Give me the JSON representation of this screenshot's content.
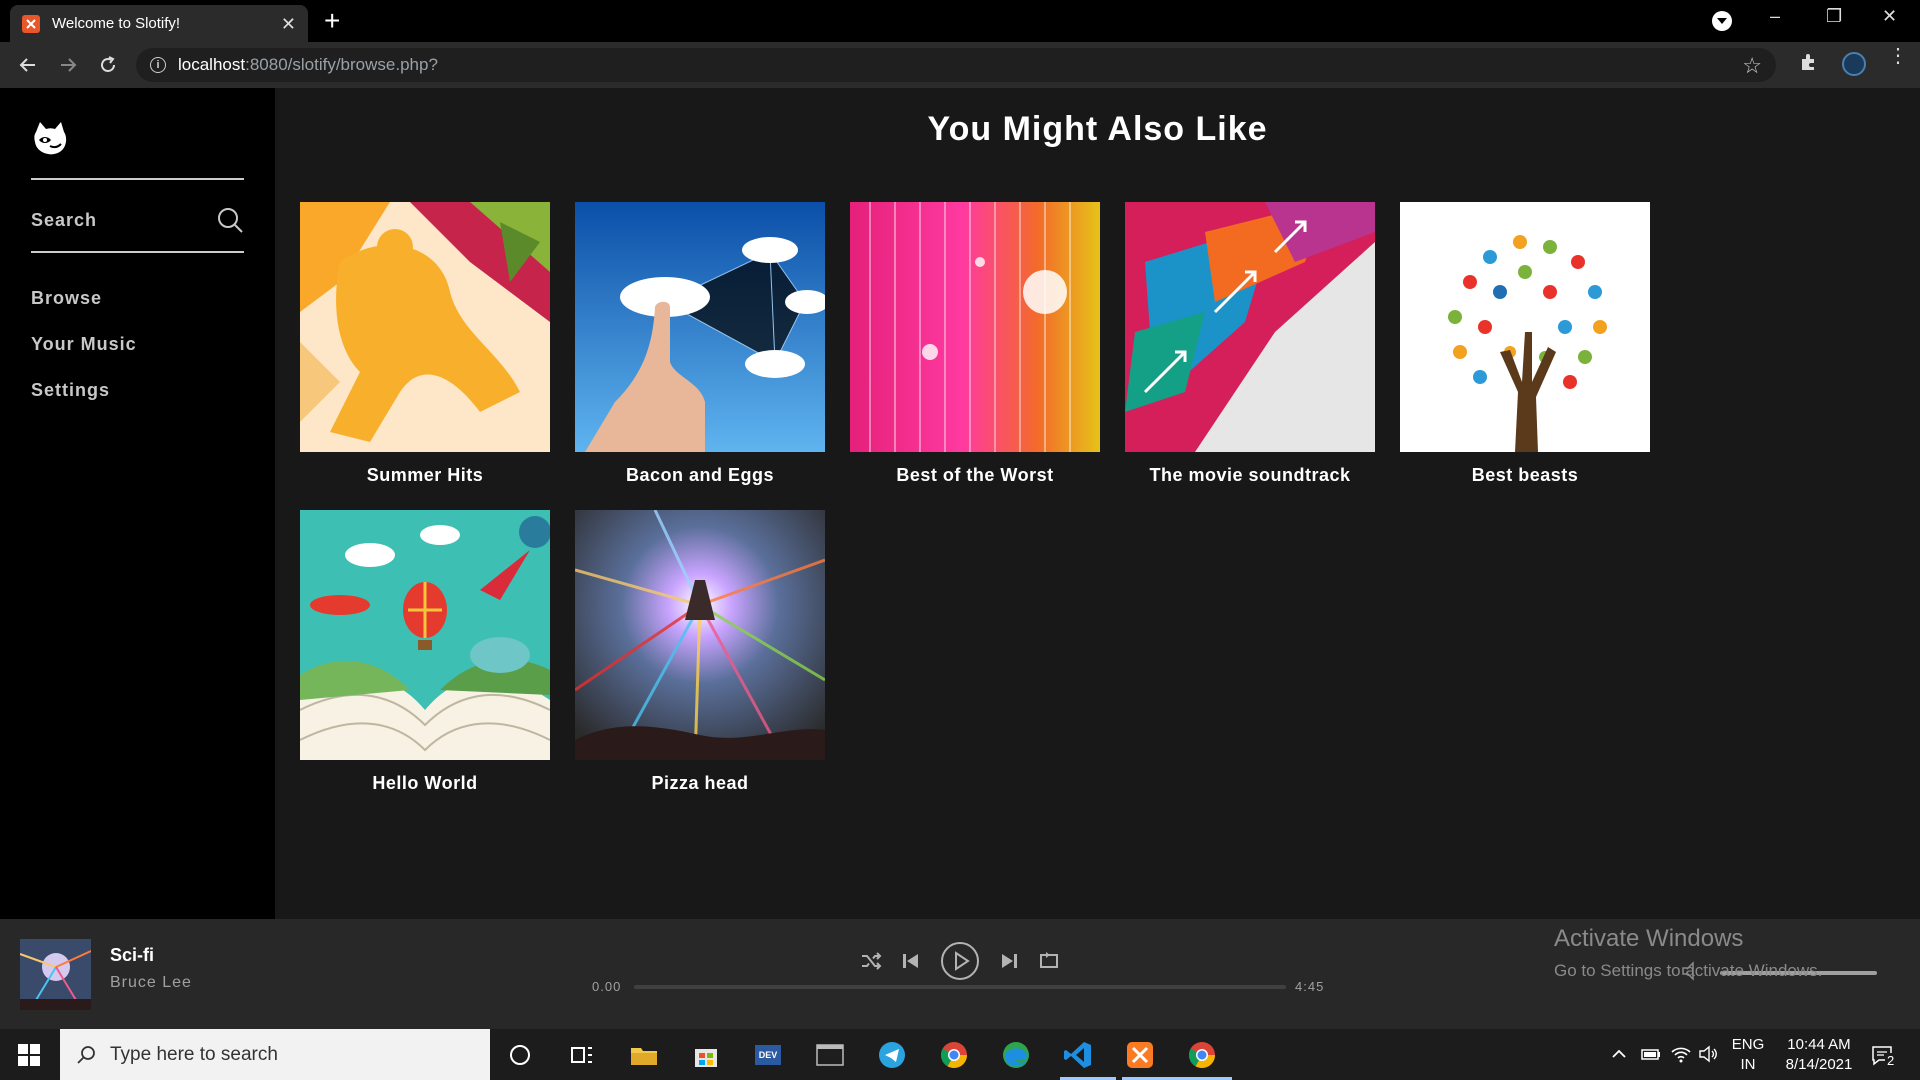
{
  "browser": {
    "tab_title": "Welcome to Slotify!",
    "tab_close": "✕",
    "new_tab": "+",
    "url_host": "localhost",
    "url_path": ":8080/slotify/browse.php?",
    "window_controls": {
      "minimize": "–",
      "restore": "❐",
      "close": "✕"
    }
  },
  "sidebar": {
    "search_label": "Search",
    "items": [
      {
        "label": "Browse"
      },
      {
        "label": "Your Music"
      },
      {
        "label": "Settings"
      }
    ]
  },
  "main": {
    "title": "You Might Also Like",
    "albums": [
      {
        "title": "Summer Hits"
      },
      {
        "title": "Bacon and Eggs"
      },
      {
        "title": "Best of the Worst"
      },
      {
        "title": "The movie soundtrack"
      },
      {
        "title": "Best beasts"
      },
      {
        "title": "Hello World"
      },
      {
        "title": "Pizza head"
      }
    ]
  },
  "player": {
    "track_title": "Sci-fi",
    "artist": "Bruce Lee",
    "current_time": "0.00",
    "duration": "4:45",
    "progress_fraction": 0,
    "volume_fraction": 1
  },
  "watermark": {
    "line1": "Activate Windows",
    "line2": "Go to Settings to activate Windows."
  },
  "taskbar": {
    "search_placeholder": "Type here to search",
    "lang_top": "ENG",
    "lang_bottom": "IN",
    "time": "10:44 AM",
    "date": "8/14/2021",
    "notification_count": "2"
  },
  "colors": {
    "sidebar_bg": "#000000",
    "content_bg": "#181818",
    "player_bg": "#282828",
    "text_muted": "#a0a0a0"
  }
}
